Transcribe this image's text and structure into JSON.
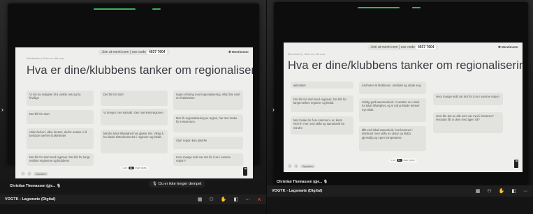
{
  "slide": {
    "join_text": "Join at menti.com | use code",
    "code": "4037 7604",
    "brand": "Mentimeter",
    "subline_left": "Mentimeter | Skriv inn ditt svar",
    "question": "Hva er dine/klubbens tanker om regionaliseringen?"
  },
  "left_cards": [
    "Vi må ha mulighet til å utvikle oss og ha frivillige",
    "Det blir for stort",
    "Ingen erfaring med regionalisering. Alltid har vært et til aktiviteter.",
    "Det blir for stort",
    "Vi trenger mer kontakt i den nye kretsregionen",
    "Mer lik regionalisering av region, har mer tenke for ressursene.",
    "Ulike behov i ulike kretser, derfor ønsker vi å beholde nærhet til aktiviteter",
    "Mindre lokal tilhørighet hos gjeste SM. Viktig å ha lokale tilstedeværelse i regionen og lokalt.",
    "Stort region kan påvirke",
    "Det blir for stort med regioner. Det blir for langt mellom regionene og klubbene",
    "Hvor mange ledd var det for å se i samme region?"
  ],
  "right_cards": [
    "aktiviteter",
    "nærheten til klubbene i området og uttale seg.",
    "Det blir for stort med regioner. Det blir for langt mellom regioner og klubb.",
    "Veldig godt sammarbeid. Vi ønsker at vi skal ha lokal tilhørighet, og vi må gi lokale kretser nye tiltak",
    "Mer lokale for å se sammen i en krets NOTIF, men ved utlån og samarbeid for mindre.",
    "Økt ved lokal samarbeid, hva kommer i etterkant med utlån av utstyr og klubb, gjensidig og egen kompetanse.",
    "Hvor mange ledd var det for å se i samme region",
    "Hvor ble det av alle som var med i kretsene? Hvordan får vi dem med igjen nå?"
  ],
  "pill": {
    "prefix": "1 av",
    "dot": "11",
    "suffix": "svar vises"
  },
  "slide_controls": {
    "btn1": "−",
    "btn2": "+",
    "label": "Speaker"
  },
  "presenter_name": "Christian Thomassen (gje...",
  "presenter_name_right": "Christian Thomassen (gje...",
  "meeting_title": "VOGTK - Lagsmøte (Digital)",
  "toolbar": {
    "chat": "▦",
    "people": "⚇",
    "react": "✋",
    "share": "◧",
    "more": "···",
    "leave": "⨯"
  },
  "mute_toast": "Du er ikke lenger dempet",
  "colors": {
    "accent_led": "#3fd36a",
    "leave": "#ff6b6b",
    "screen_bg": "#eeeeec",
    "card_bg": "#e2e2df"
  }
}
